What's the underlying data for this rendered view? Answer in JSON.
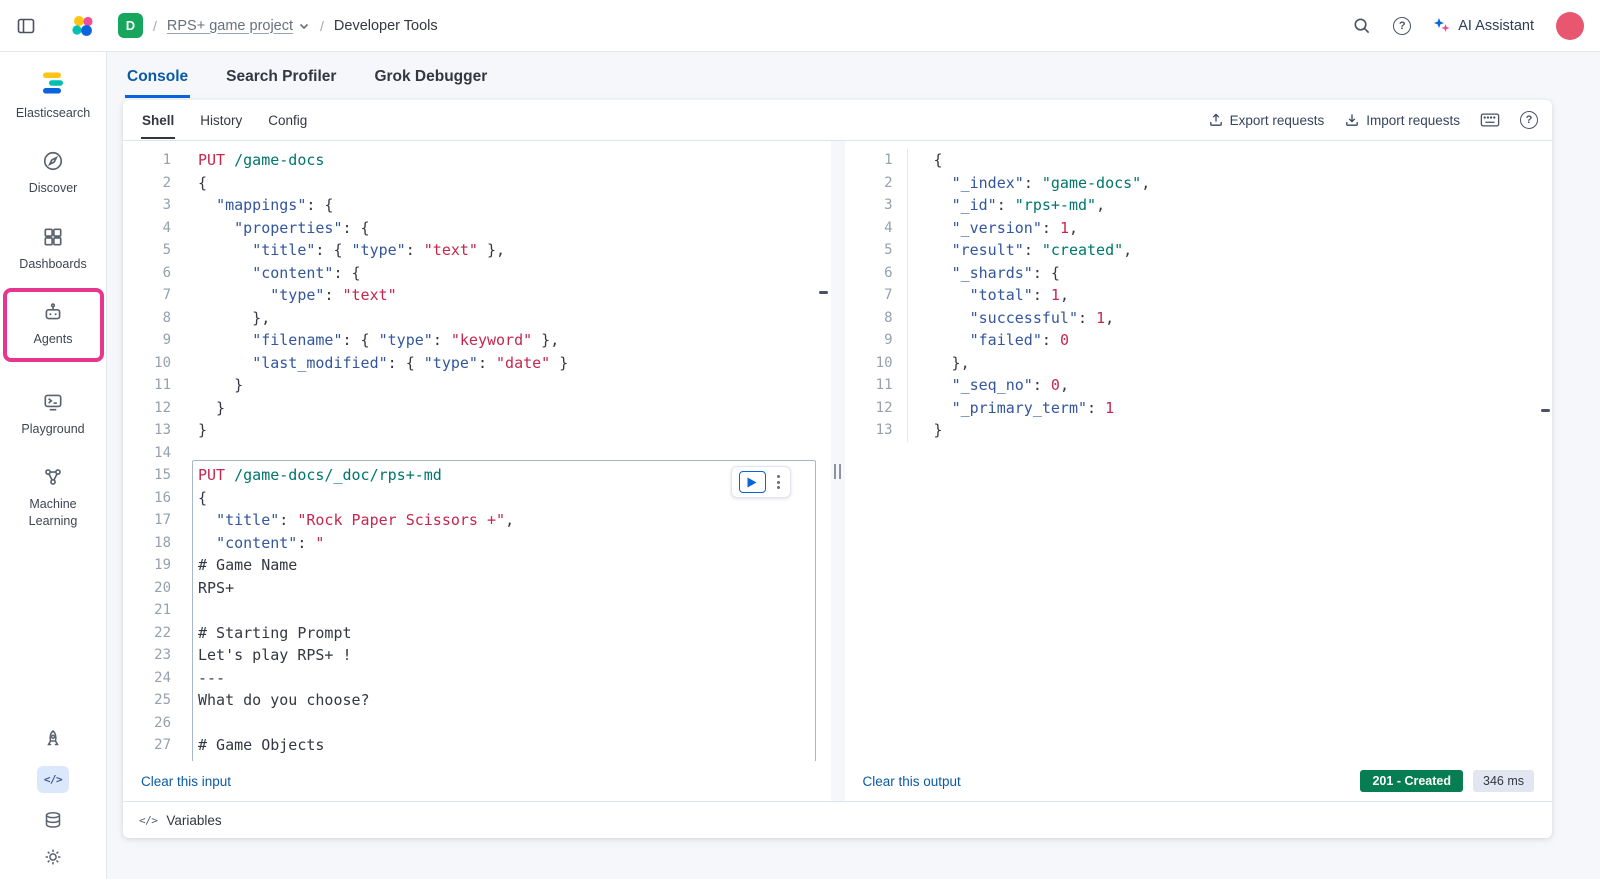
{
  "header": {
    "space_badge": "D",
    "breadcrumb_separator": "/",
    "project_name": "RPS+ game project",
    "page_name": "Developer Tools",
    "ai_assistant_label": "AI Assistant",
    "icons": [
      "nav-toggle-icon",
      "elastic-logo",
      "search-icon",
      "help-icon",
      "ai-assistant-icon",
      "user-avatar"
    ]
  },
  "sidebar": {
    "product": "Elasticsearch",
    "items": [
      {
        "label": "Discover",
        "icon": "discover-icon"
      },
      {
        "label": "Dashboards",
        "icon": "dashboards-icon"
      },
      {
        "label": "Agents",
        "icon": "agents-icon",
        "annotated": true
      },
      {
        "label": "Playground",
        "icon": "playground-icon"
      },
      {
        "label": "Machine Learning",
        "icon": "machine-learning-icon"
      }
    ],
    "bottom_icons": [
      "rocket-icon",
      "code-icon",
      "database-icon",
      "gear-icon"
    ],
    "code_icon_glyph": "</>"
  },
  "tabs": [
    {
      "label": "Console",
      "active": true
    },
    {
      "label": "Search Profiler",
      "active": false
    },
    {
      "label": "Grok Debugger",
      "active": false
    }
  ],
  "console": {
    "subtabs": [
      {
        "label": "Shell",
        "active": true
      },
      {
        "label": "History",
        "active": false
      },
      {
        "label": "Config",
        "active": false
      }
    ],
    "actions": {
      "export_label": "Export requests",
      "import_label": "Import requests"
    },
    "input": {
      "clear_label": "Clear this input",
      "first_line_number": 1,
      "selected_request": {
        "from_line": 15,
        "to_line": 27
      },
      "lines": [
        [
          [
            "m",
            "PUT"
          ],
          [
            "p",
            " "
          ],
          [
            "u",
            "/game-docs"
          ]
        ],
        [
          [
            "p",
            "{"
          ]
        ],
        [
          [
            "p",
            "  "
          ],
          [
            "k",
            "\"mappings\""
          ],
          [
            "p",
            ": {"
          ]
        ],
        [
          [
            "p",
            "    "
          ],
          [
            "k",
            "\"properties\""
          ],
          [
            "p",
            ": {"
          ]
        ],
        [
          [
            "p",
            "      "
          ],
          [
            "k",
            "\"title\""
          ],
          [
            "p",
            ": { "
          ],
          [
            "k",
            "\"type\""
          ],
          [
            "p",
            ": "
          ],
          [
            "s",
            "\"text\""
          ],
          [
            "p",
            " },"
          ]
        ],
        [
          [
            "p",
            "      "
          ],
          [
            "k",
            "\"content\""
          ],
          [
            "p",
            ": {"
          ]
        ],
        [
          [
            "p",
            "        "
          ],
          [
            "k",
            "\"type\""
          ],
          [
            "p",
            ": "
          ],
          [
            "s",
            "\"text\""
          ]
        ],
        [
          [
            "p",
            "      },"
          ]
        ],
        [
          [
            "p",
            "      "
          ],
          [
            "k",
            "\"filename\""
          ],
          [
            "p",
            ": { "
          ],
          [
            "k",
            "\"type\""
          ],
          [
            "p",
            ": "
          ],
          [
            "s",
            "\"keyword\""
          ],
          [
            "p",
            " },"
          ]
        ],
        [
          [
            "p",
            "      "
          ],
          [
            "k",
            "\"last_modified\""
          ],
          [
            "p",
            ": { "
          ],
          [
            "k",
            "\"type\""
          ],
          [
            "p",
            ": "
          ],
          [
            "s",
            "\"date\""
          ],
          [
            "p",
            " }"
          ]
        ],
        [
          [
            "p",
            "    }"
          ]
        ],
        [
          [
            "p",
            "  }"
          ]
        ],
        [
          [
            "p",
            "}"
          ]
        ],
        [],
        [
          [
            "m",
            "PUT"
          ],
          [
            "p",
            " "
          ],
          [
            "u",
            "/game-docs/_doc/rps+-md"
          ]
        ],
        [
          [
            "p",
            "{"
          ]
        ],
        [
          [
            "p",
            "  "
          ],
          [
            "k",
            "\"title\""
          ],
          [
            "p",
            ": "
          ],
          [
            "s",
            "\"Rock Paper Scissors +\""
          ],
          [
            "p",
            ","
          ]
        ],
        [
          [
            "p",
            "  "
          ],
          [
            "k",
            "\"content\""
          ],
          [
            "p",
            ": "
          ],
          [
            "s",
            "\""
          ]
        ],
        [
          [
            "p",
            "# Game Name"
          ]
        ],
        [
          [
            "p",
            "RPS+"
          ]
        ],
        [],
        [
          [
            "p",
            "# Starting Prompt"
          ]
        ],
        [
          [
            "p",
            "Let's play RPS+ !"
          ]
        ],
        [
          [
            "p",
            "---"
          ]
        ],
        [
          [
            "p",
            "What do you choose?"
          ]
        ],
        [],
        [
          [
            "p",
            "# Game Objects"
          ]
        ]
      ]
    },
    "output": {
      "clear_label": "Clear this output",
      "first_line_number": 1,
      "lines": [
        [
          [
            "p",
            "{"
          ]
        ],
        [
          [
            "p",
            "  "
          ],
          [
            "k",
            "\"_index\""
          ],
          [
            "p",
            ": "
          ],
          [
            "t",
            "\"game-docs\""
          ],
          [
            "p",
            ","
          ]
        ],
        [
          [
            "p",
            "  "
          ],
          [
            "k",
            "\"_id\""
          ],
          [
            "p",
            ": "
          ],
          [
            "t",
            "\"rps+-md\""
          ],
          [
            "p",
            ","
          ]
        ],
        [
          [
            "p",
            "  "
          ],
          [
            "k",
            "\"_version\""
          ],
          [
            "p",
            ": "
          ],
          [
            "s",
            "1"
          ],
          [
            "p",
            ","
          ]
        ],
        [
          [
            "p",
            "  "
          ],
          [
            "k",
            "\"result\""
          ],
          [
            "p",
            ": "
          ],
          [
            "t",
            "\"created\""
          ],
          [
            "p",
            ","
          ]
        ],
        [
          [
            "p",
            "  "
          ],
          [
            "k",
            "\"_shards\""
          ],
          [
            "p",
            ": {"
          ]
        ],
        [
          [
            "p",
            "    "
          ],
          [
            "k",
            "\"total\""
          ],
          [
            "p",
            ": "
          ],
          [
            "s",
            "1"
          ],
          [
            "p",
            ","
          ]
        ],
        [
          [
            "p",
            "    "
          ],
          [
            "k",
            "\"successful\""
          ],
          [
            "p",
            ": "
          ],
          [
            "s",
            "1"
          ],
          [
            "p",
            ","
          ]
        ],
        [
          [
            "p",
            "    "
          ],
          [
            "k",
            "\"failed\""
          ],
          [
            "p",
            ": "
          ],
          [
            "s",
            "0"
          ]
        ],
        [
          [
            "p",
            "  },"
          ]
        ],
        [
          [
            "p",
            "  "
          ],
          [
            "k",
            "\"_seq_no\""
          ],
          [
            "p",
            ": "
          ],
          [
            "s",
            "0"
          ],
          [
            "p",
            ","
          ]
        ],
        [
          [
            "p",
            "  "
          ],
          [
            "k",
            "\"_primary_term\""
          ],
          [
            "p",
            ": "
          ],
          [
            "s",
            "1"
          ]
        ],
        [
          [
            "p",
            "}"
          ]
        ]
      ]
    },
    "response": {
      "status": "201 - Created",
      "time": "346 ms"
    },
    "variables_label": "Variables",
    "variables_icon": "</>"
  },
  "colors": {
    "accent_blue": "#0b64dd",
    "link_blue": "#0a5aa6",
    "annotation_pink": "#e8368f",
    "success_green": "#077d54",
    "code_red": "#c5264e",
    "code_teal": "#00756c",
    "code_key_blue": "#33569c",
    "space_badge_green": "#16a65c",
    "avatar_pink": "#e8566f"
  }
}
